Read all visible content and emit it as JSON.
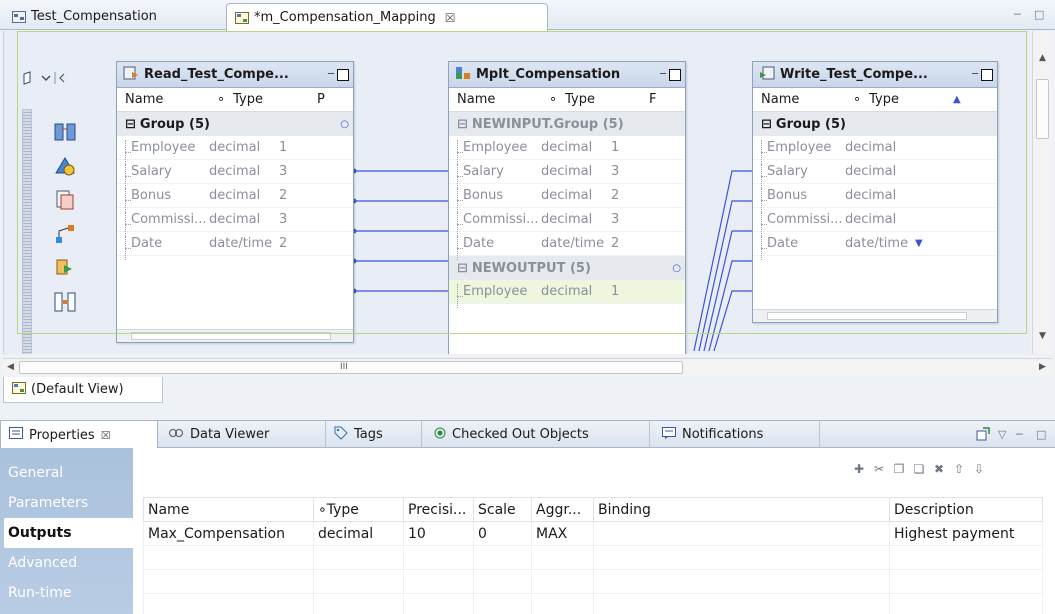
{
  "editor_tabs": [
    {
      "label": "Test_Compensation",
      "active": false
    },
    {
      "label": "*m_Compensation_Mapping",
      "active": true,
      "close": "☒"
    }
  ],
  "canvas": {
    "read_box": {
      "title": "Read_Test_Compe...",
      "col_name": "Name",
      "col_type": "Type",
      "col_extra": "P",
      "group": "Group (5)",
      "ports": [
        {
          "name": "Employee",
          "type": "decimal",
          "prec": "1"
        },
        {
          "name": "Salary",
          "type": "decimal",
          "prec": "3"
        },
        {
          "name": "Bonus",
          "type": "decimal",
          "prec": "2"
        },
        {
          "name": "Commissi...",
          "type": "decimal",
          "prec": "3"
        },
        {
          "name": "Date",
          "type": "date/time",
          "prec": "2"
        }
      ]
    },
    "mplt_box": {
      "title": "Mplt_Compensation",
      "col_name": "Name",
      "col_type": "Type",
      "col_extra": "F",
      "group_in": "NEWINPUT.Group (5)",
      "ports": [
        {
          "name": "Employee",
          "type": "decimal",
          "prec": "1"
        },
        {
          "name": "Salary",
          "type": "decimal",
          "prec": "3"
        },
        {
          "name": "Bonus",
          "type": "decimal",
          "prec": "2"
        },
        {
          "name": "Commissi...",
          "type": "decimal",
          "prec": "3"
        },
        {
          "name": "Date",
          "type": "date/time",
          "prec": "2"
        }
      ],
      "group_out": "NEWOUTPUT (5)",
      "out_ports": [
        {
          "name": "Employee",
          "type": "decimal",
          "prec": "1"
        }
      ]
    },
    "write_box": {
      "title": "Write_Test_Compe...",
      "col_name": "Name",
      "col_type": "Type",
      "group": "Group (5)",
      "ports": [
        {
          "name": "Employee",
          "type": "decimal"
        },
        {
          "name": "Salary",
          "type": "decimal"
        },
        {
          "name": "Bonus",
          "type": "decimal"
        },
        {
          "name": "Commissi...",
          "type": "decimal"
        },
        {
          "name": "Date",
          "type": "date/time"
        }
      ]
    },
    "hscroll_mark": "III"
  },
  "default_view": "(Default View)",
  "bottom_tabs": [
    {
      "label": "Properties",
      "icon": "properties-icon",
      "active": true
    },
    {
      "label": "Data Viewer",
      "icon": "data-viewer-icon"
    },
    {
      "label": "Tags",
      "icon": "tag-icon"
    },
    {
      "label": "Checked Out Objects",
      "icon": "checked-out-icon"
    },
    {
      "label": "Notifications",
      "icon": "notifications-icon"
    }
  ],
  "side_nav": [
    "General",
    "Parameters",
    "Outputs",
    "Advanced",
    "Run-time"
  ],
  "side_nav_selected": "Outputs",
  "outputs_table": {
    "headers": [
      "Name",
      "Type",
      "Precisi...",
      "Scale",
      "Aggr...",
      "Binding",
      "Description"
    ],
    "rows": [
      [
        "Max_Compensation",
        "decimal",
        "10",
        "0",
        "MAX",
        "",
        "Highest payment"
      ]
    ],
    "empty_rows": 3
  },
  "colors": {
    "accent": "#aac1dc",
    "link_line": "#3d53d6",
    "selection": "#b6d77c"
  }
}
